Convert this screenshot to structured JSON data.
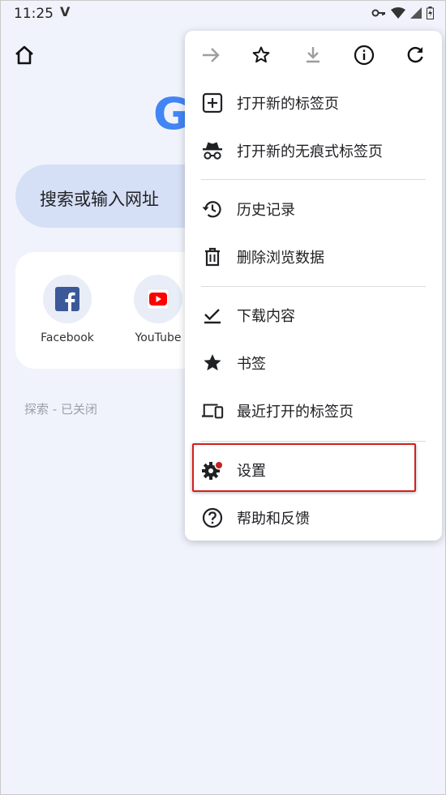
{
  "status_bar": {
    "time": "11:25",
    "indicator": "V",
    "icons": [
      "key-icon",
      "wifi-icon",
      "signal-icon",
      "battery-icon"
    ]
  },
  "ntp": {
    "logo_letter": "G",
    "search_placeholder": "搜索或输入网址",
    "shortcuts": [
      {
        "label": "Facebook",
        "icon": "facebook-icon"
      },
      {
        "label": "YouTube",
        "icon": "youtube-icon"
      }
    ],
    "discover_status": "探索 - 已关闭"
  },
  "menu": {
    "toolbar": [
      "forward-icon",
      "bookmark-star-icon",
      "download-icon",
      "info-icon",
      "reload-icon"
    ],
    "groups": [
      {
        "items": [
          {
            "label": "打开新的标签页",
            "icon": "new-tab-icon"
          },
          {
            "label": "打开新的无痕式标签页",
            "icon": "incognito-icon"
          }
        ]
      },
      {
        "items": [
          {
            "label": "历史记录",
            "icon": "history-icon"
          },
          {
            "label": "删除浏览数据",
            "icon": "trash-icon"
          }
        ]
      },
      {
        "items": [
          {
            "label": "下载内容",
            "icon": "download-check-icon"
          },
          {
            "label": "书签",
            "icon": "star-icon"
          },
          {
            "label": "最近打开的标签页",
            "icon": "devices-icon"
          }
        ]
      },
      {
        "items": [
          {
            "label": "设置",
            "icon": "settings-gear-icon",
            "highlighted": true
          },
          {
            "label": "帮助和反馈",
            "icon": "help-icon"
          }
        ]
      }
    ]
  },
  "colors": {
    "background": "#f1f3fc",
    "search_box": "#d5dff5",
    "google_blue": "#4285f4",
    "highlight_border": "#d32020",
    "notification_dot": "#c5221f"
  }
}
